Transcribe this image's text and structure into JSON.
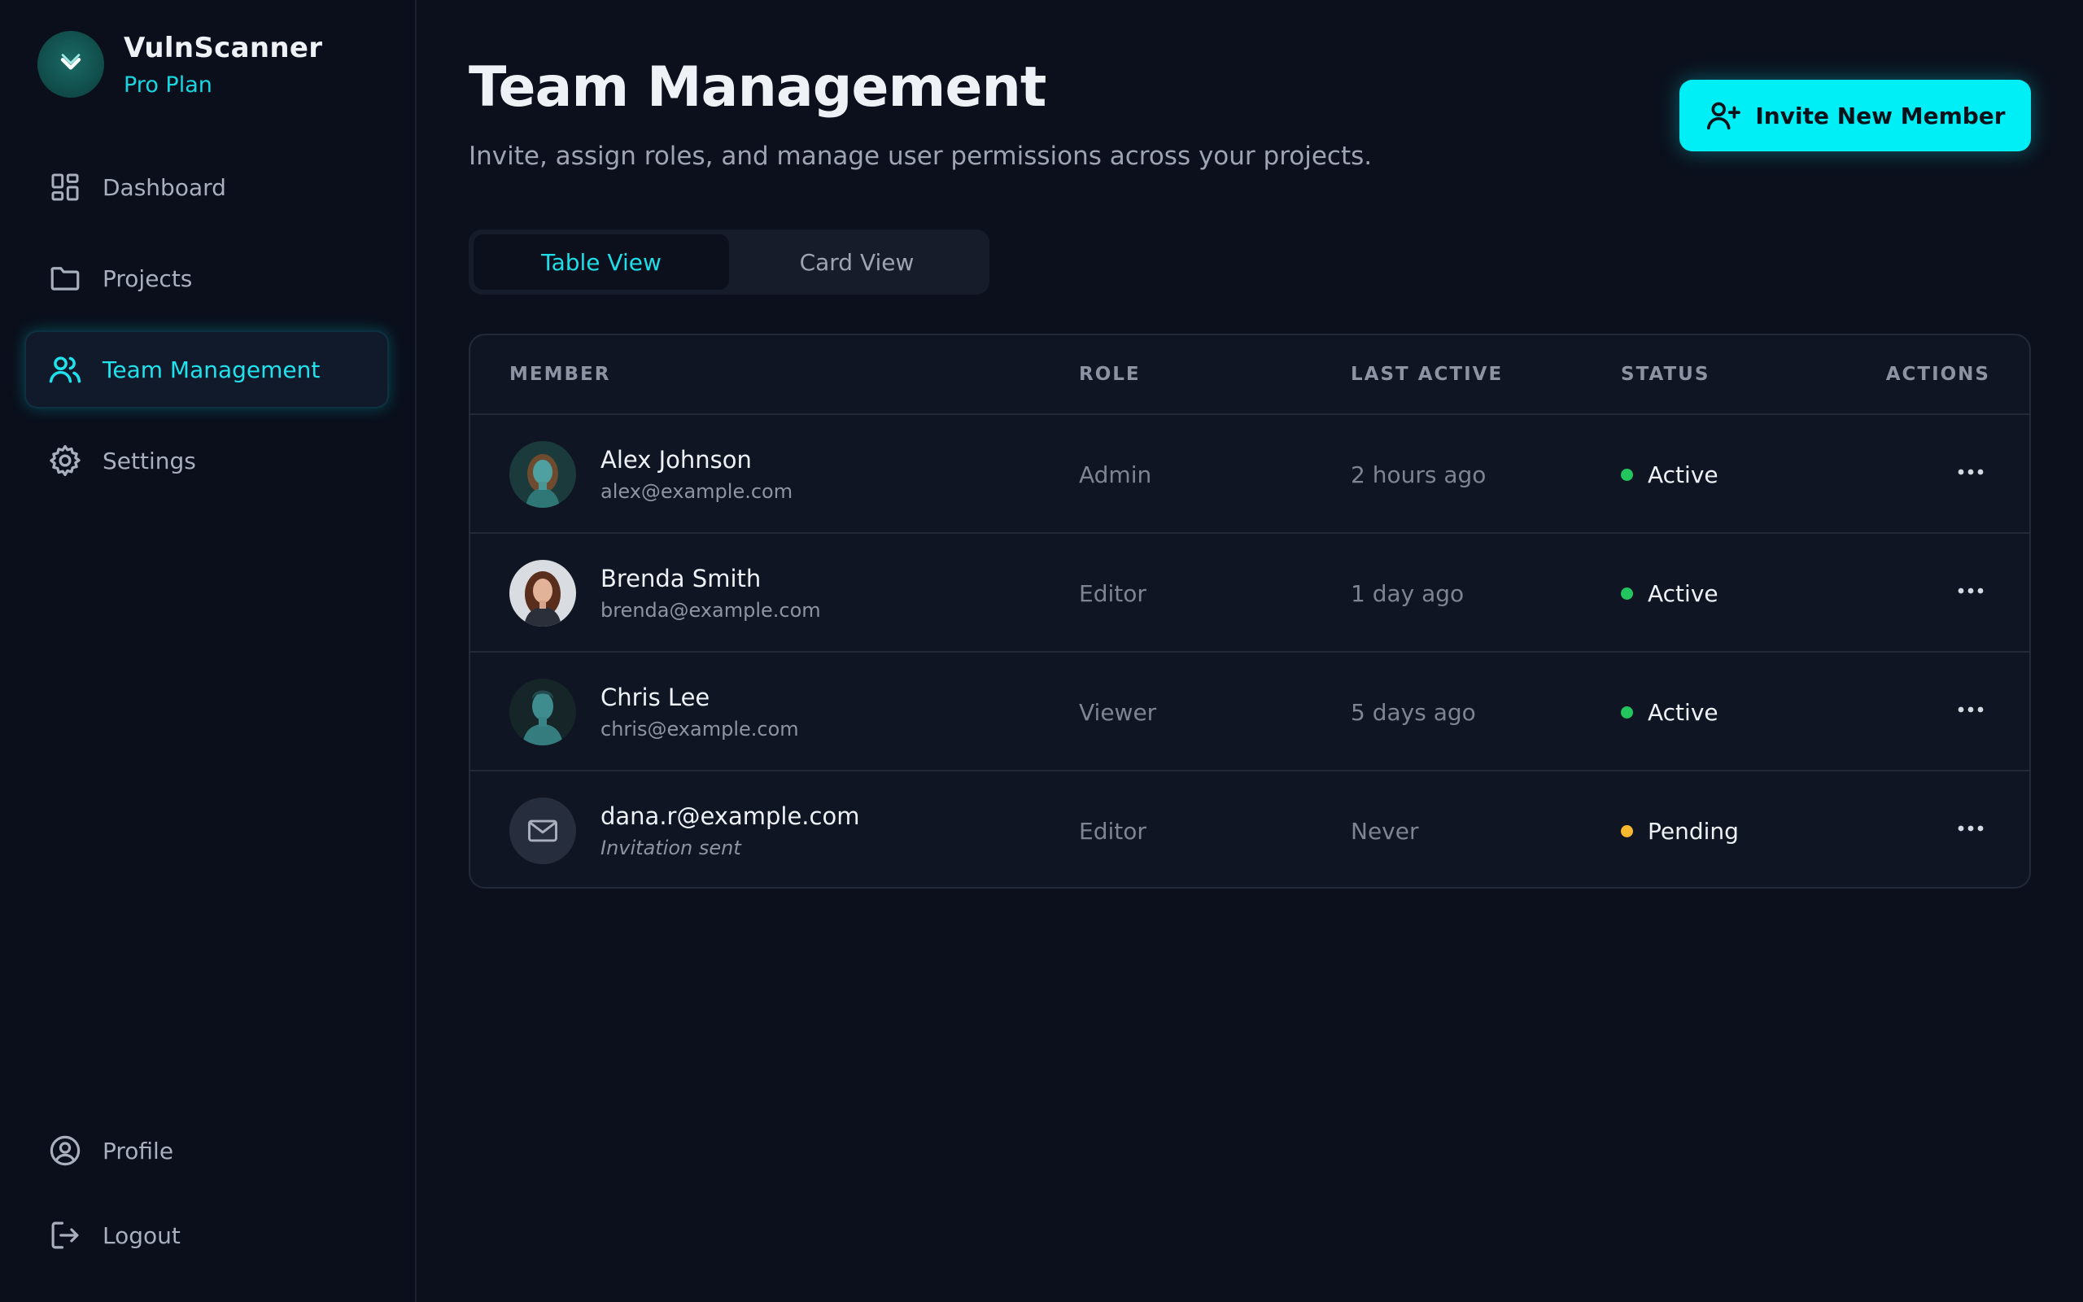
{
  "brand": {
    "name": "VulnScanner",
    "plan": "Pro Plan"
  },
  "nav": [
    {
      "label": "Dashboard",
      "icon": "dashboard-icon",
      "active": false
    },
    {
      "label": "Projects",
      "icon": "folder-icon",
      "active": false
    },
    {
      "label": "Team Management",
      "icon": "users-icon",
      "active": true
    },
    {
      "label": "Settings",
      "icon": "gear-icon",
      "active": false
    }
  ],
  "nav_bottom": [
    {
      "label": "Profile",
      "icon": "user-circle-icon"
    },
    {
      "label": "Logout",
      "icon": "logout-icon"
    }
  ],
  "header": {
    "title": "Team Management",
    "subtitle": "Invite, assign roles, and manage user permissions across your projects.",
    "invite_label": "Invite New Member"
  },
  "views": {
    "table": "Table View",
    "card": "Card View",
    "active": "table"
  },
  "table": {
    "headers": {
      "member": "MEMBER",
      "role": "ROLE",
      "last_active": "LAST ACTIVE",
      "status": "STATUS",
      "actions": "ACTIONS"
    },
    "rows": [
      {
        "name": "Alex Johnson",
        "email": "alex@example.com",
        "role": "Admin",
        "last_active": "2 hours ago",
        "status": "Active",
        "status_color": "#22c55e",
        "avatar": "teal-portrait"
      },
      {
        "name": "Brenda Smith",
        "email": "brenda@example.com",
        "role": "Editor",
        "last_active": "1 day ago",
        "status": "Active",
        "status_color": "#22c55e",
        "avatar": "photo-portrait"
      },
      {
        "name": "Chris Lee",
        "email": "chris@example.com",
        "role": "Viewer",
        "last_active": "5 days ago",
        "status": "Active",
        "status_color": "#22c55e",
        "avatar": "teal-portrait"
      },
      {
        "name": "dana.r@example.com",
        "email": "Invitation sent",
        "role": "Editor",
        "last_active": "Never",
        "status": "Pending",
        "status_color": "#f5b82e",
        "avatar": "mail-icon"
      }
    ]
  },
  "colors": {
    "accent": "#00eef6",
    "background": "#0b101c",
    "active": "#22c55e",
    "pending": "#f5b82e"
  }
}
